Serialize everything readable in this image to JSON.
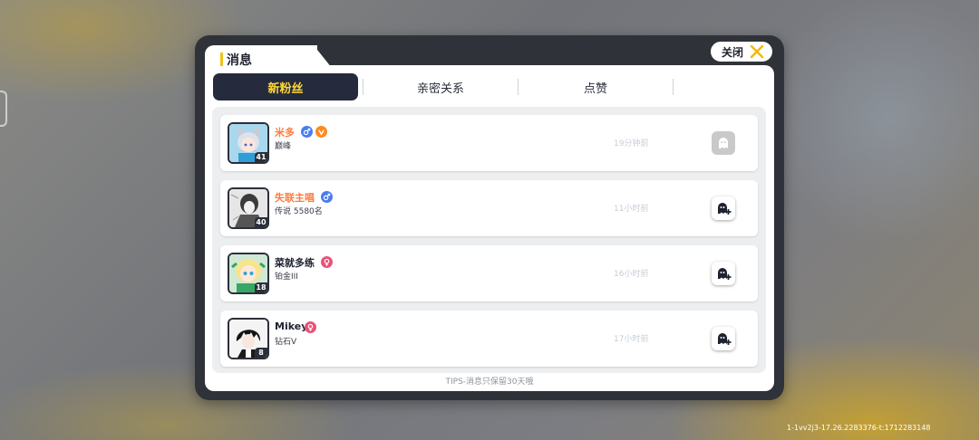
{
  "dialog": {
    "title": "消息",
    "close_label": "关闭"
  },
  "tabs": [
    {
      "label": "新粉丝",
      "active": true
    },
    {
      "label": "亲密关系",
      "active": false
    },
    {
      "label": "点赞",
      "active": false
    }
  ],
  "followers": [
    {
      "name": "米多",
      "name_color": "#ff7a3d",
      "rank": "巅峰",
      "level": "41",
      "time": "19分钟前",
      "badges": [
        "male-icon",
        "vip-icon"
      ],
      "action": "followed-icon"
    },
    {
      "name": "失联主唱",
      "name_color": "#ff7a3d",
      "rank": "传说 5580名",
      "level": "40",
      "time": "11小时前",
      "badges": [
        "male-icon"
      ],
      "action": "add-follow-icon"
    },
    {
      "name": "菜就多练",
      "name_color": "#1e2230",
      "rank": "铂金III",
      "level": "18",
      "time": "16小时前",
      "badges": [
        "female-icon"
      ],
      "action": "add-follow-icon"
    },
    {
      "name": "Mikey",
      "name_color": "#1e2230",
      "rank": "钻石V",
      "level": "8",
      "time": "17小时前",
      "badges": [
        "female-icon"
      ],
      "action": "add-follow-icon"
    }
  ],
  "tips": "TIPS-消息只保留30天哦",
  "build_id": "1-1vv2j3-17.26.2283376-t:1712283148",
  "colors": {
    "accent_yellow": "#ffd83a",
    "dark_navy": "#252b3d",
    "male_blue": "#4a7cf0",
    "female_pink": "#ea5479",
    "vip_orange": "#ff8a1f"
  }
}
